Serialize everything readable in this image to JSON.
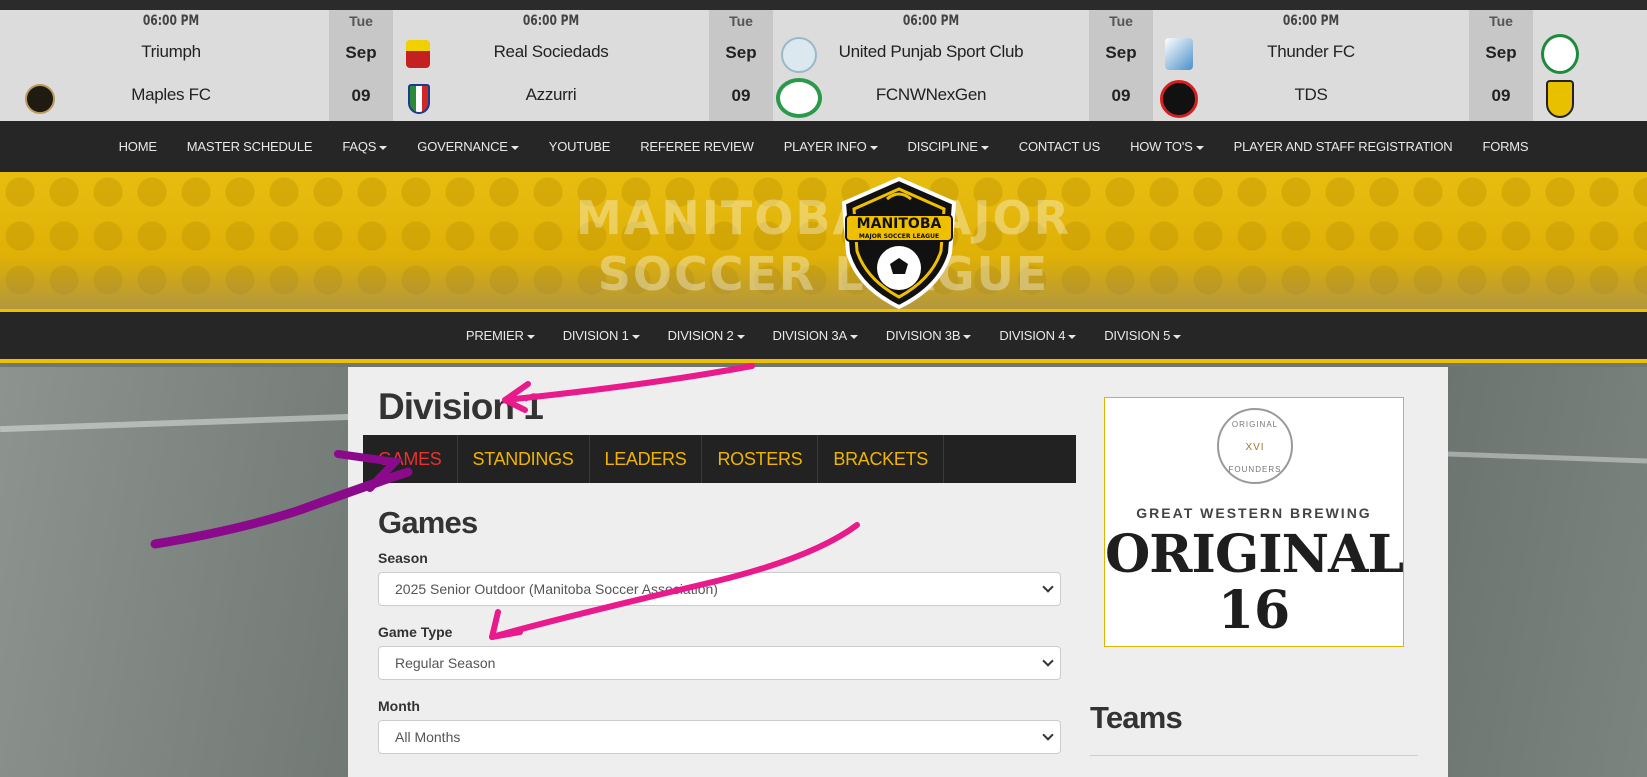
{
  "ticker": {
    "games": [
      {
        "time": "06:00 PM",
        "home": "Triumph",
        "away": "Maples FC"
      },
      {
        "time": "06:00 PM",
        "home": "Real Sociedads",
        "away": "Azzurri"
      },
      {
        "time": "06:00 PM",
        "home": "United Punjab Sport Club",
        "away": "FCNWNexGen"
      },
      {
        "time": "06:00 PM",
        "home": "Thunder FC",
        "away": "TDS"
      }
    ],
    "dates": [
      {
        "dow": "Tue",
        "mon": "Sep",
        "day": "09"
      },
      {
        "dow": "Tue",
        "mon": "Sep",
        "day": "09"
      },
      {
        "dow": "Tue",
        "mon": "Sep",
        "day": "09"
      },
      {
        "dow": "Tue",
        "mon": "Sep",
        "day": "09"
      }
    ]
  },
  "main_nav": [
    "HOME",
    "MASTER SCHEDULE",
    "FAQS",
    "GOVERNANCE",
    "YOUTUBE",
    "REFEREE REVIEW",
    "PLAYER INFO",
    "DISCIPLINE",
    "CONTACT US",
    "HOW TO'S",
    "PLAYER AND STAFF REGISTRATION",
    "FORMS"
  ],
  "banner": {
    "line1": "MANITOBA MAJOR",
    "line2": "SOCCER LEAGUE",
    "logo_title": "MANITOBA",
    "logo_sub": "MAJOR SOCCER LEAGUE"
  },
  "division_nav": [
    "PREMIER",
    "DIVISION 1",
    "DIVISION 2",
    "DIVISION 3A",
    "DIVISION 3B",
    "DIVISION 4",
    "DIVISION 5"
  ],
  "page": {
    "title": "Division 1",
    "tabs": [
      "GAMES",
      "STANDINGS",
      "LEADERS",
      "ROSTERS",
      "BRACKETS"
    ],
    "section_title": "Games",
    "season_label": "Season",
    "season_value": "2025 Senior Outdoor (Manitoba Soccer Association)",
    "game_type_label": "Game Type",
    "game_type_value": "Regular Season",
    "month_label": "Month",
    "month_value": "All Months"
  },
  "sidebar": {
    "ad_badge_top": "ORIGINAL",
    "ad_badge_mid": "XVI",
    "ad_badge_bottom": "FOUNDERS",
    "ad_brewer": "GREAT WESTERN BREWING",
    "ad_brand": "ORIGINAL",
    "ad_brand_num": "16",
    "teams_title": "Teams"
  },
  "colors": {
    "dark_bar": "#262626",
    "gold": "#f0c000",
    "tab_gold": "#f0b400",
    "active_red": "#e83232",
    "annotation_pink": "#e81a8c",
    "annotation_purple": "#8b0a8b"
  }
}
